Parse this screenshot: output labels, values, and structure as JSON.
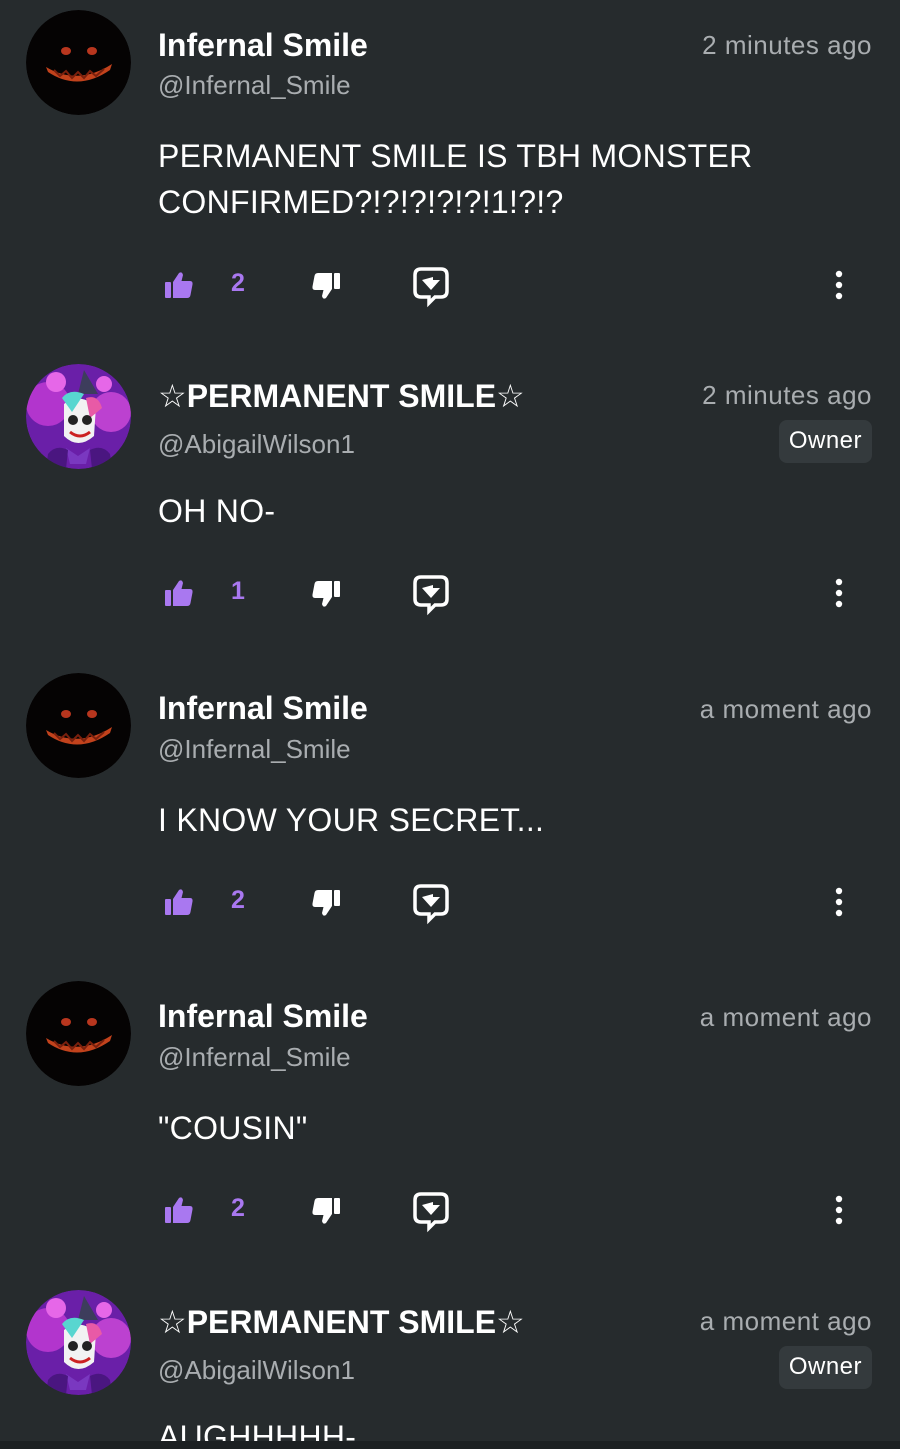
{
  "comments": [
    {
      "name": "Infernal Smile",
      "handle": "@Infernal_Smile",
      "time": "2 minutes ago",
      "text": "PERMANENT SMILE IS TBH MONSTER CONFIRMED?!?!?!?!?!1!?!?",
      "likes": "2",
      "avatar": "dark-smile-avatar"
    },
    {
      "name": "☆PERMANENT SMILE☆",
      "handle": "@AbigailWilson1",
      "time": "2 minutes ago",
      "badge": "Owner",
      "text": "OH NO-",
      "likes": "1",
      "avatar": "clown-avatar"
    },
    {
      "name": "Infernal Smile",
      "handle": "@Infernal_Smile",
      "time": "a moment ago",
      "text": "I KNOW YOUR SECRET...",
      "likes": "2",
      "avatar": "dark-smile-avatar"
    },
    {
      "name": "Infernal Smile",
      "handle": "@Infernal_Smile",
      "time": "a moment ago",
      "text": "\"COUSIN\"",
      "likes": "2",
      "avatar": "dark-smile-avatar"
    },
    {
      "name": "☆PERMANENT SMILE☆",
      "handle": "@AbigailWilson1",
      "time": "a moment ago",
      "badge": "Owner",
      "text": "AUGHHHHH-",
      "avatar": "clown-avatar"
    }
  ],
  "icons": {
    "like": "thumbs-up-icon",
    "dislike": "thumbs-down-icon",
    "reply": "reply-bubble-icon",
    "more": "more-vertical-icon"
  },
  "colors": {
    "background": "#262b2d",
    "accent": "#a978f0",
    "muted_text": "#a9adb0",
    "badge_bg": "#343a3d"
  }
}
